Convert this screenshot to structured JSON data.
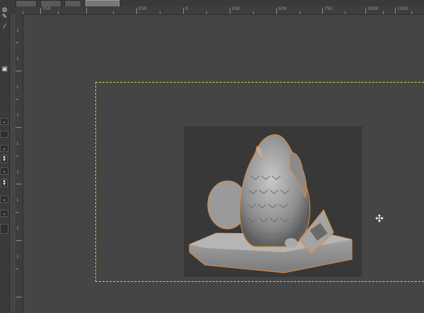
{
  "thumbnails": [
    "image-1",
    "image-2",
    "image-3",
    "image-4"
  ],
  "ruler_top_labels": [
    "750",
    "250",
    "0",
    "250",
    "500",
    "750",
    "1000",
    "1250"
  ],
  "ruler_left_labels": [
    "1",
    "1",
    "1",
    "1",
    "1",
    "1",
    "1",
    "1",
    "1"
  ],
  "left_panel": {
    "icons": [
      "gear-icon",
      "pencil-icon",
      "eyedropper-icon",
      "fit-icon"
    ],
    "dropdown_glyph": "⌄"
  },
  "canvas": {
    "selection_color": "#d8d23a",
    "model_outline_color": "#e08a3a",
    "subject": "3D-printed owl model on a hexagonal base"
  },
  "cursor_glyph": "✣"
}
